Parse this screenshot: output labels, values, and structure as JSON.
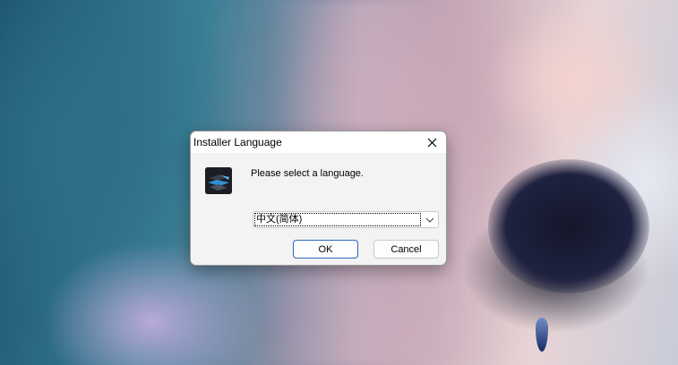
{
  "dialog": {
    "title": "Installer Language",
    "close_icon": "close-icon",
    "app_icon": "installer-app-icon",
    "message": "Please select a language.",
    "language_select": {
      "selected": "中文(简体)",
      "dropdown_icon": "chevron-down-icon"
    },
    "ok_label": "OK",
    "cancel_label": "Cancel"
  },
  "colors": {
    "dialog_background": "#f3f3f3",
    "titlebar_background": "#ffffff",
    "default_button_border": "#2a68b4"
  }
}
